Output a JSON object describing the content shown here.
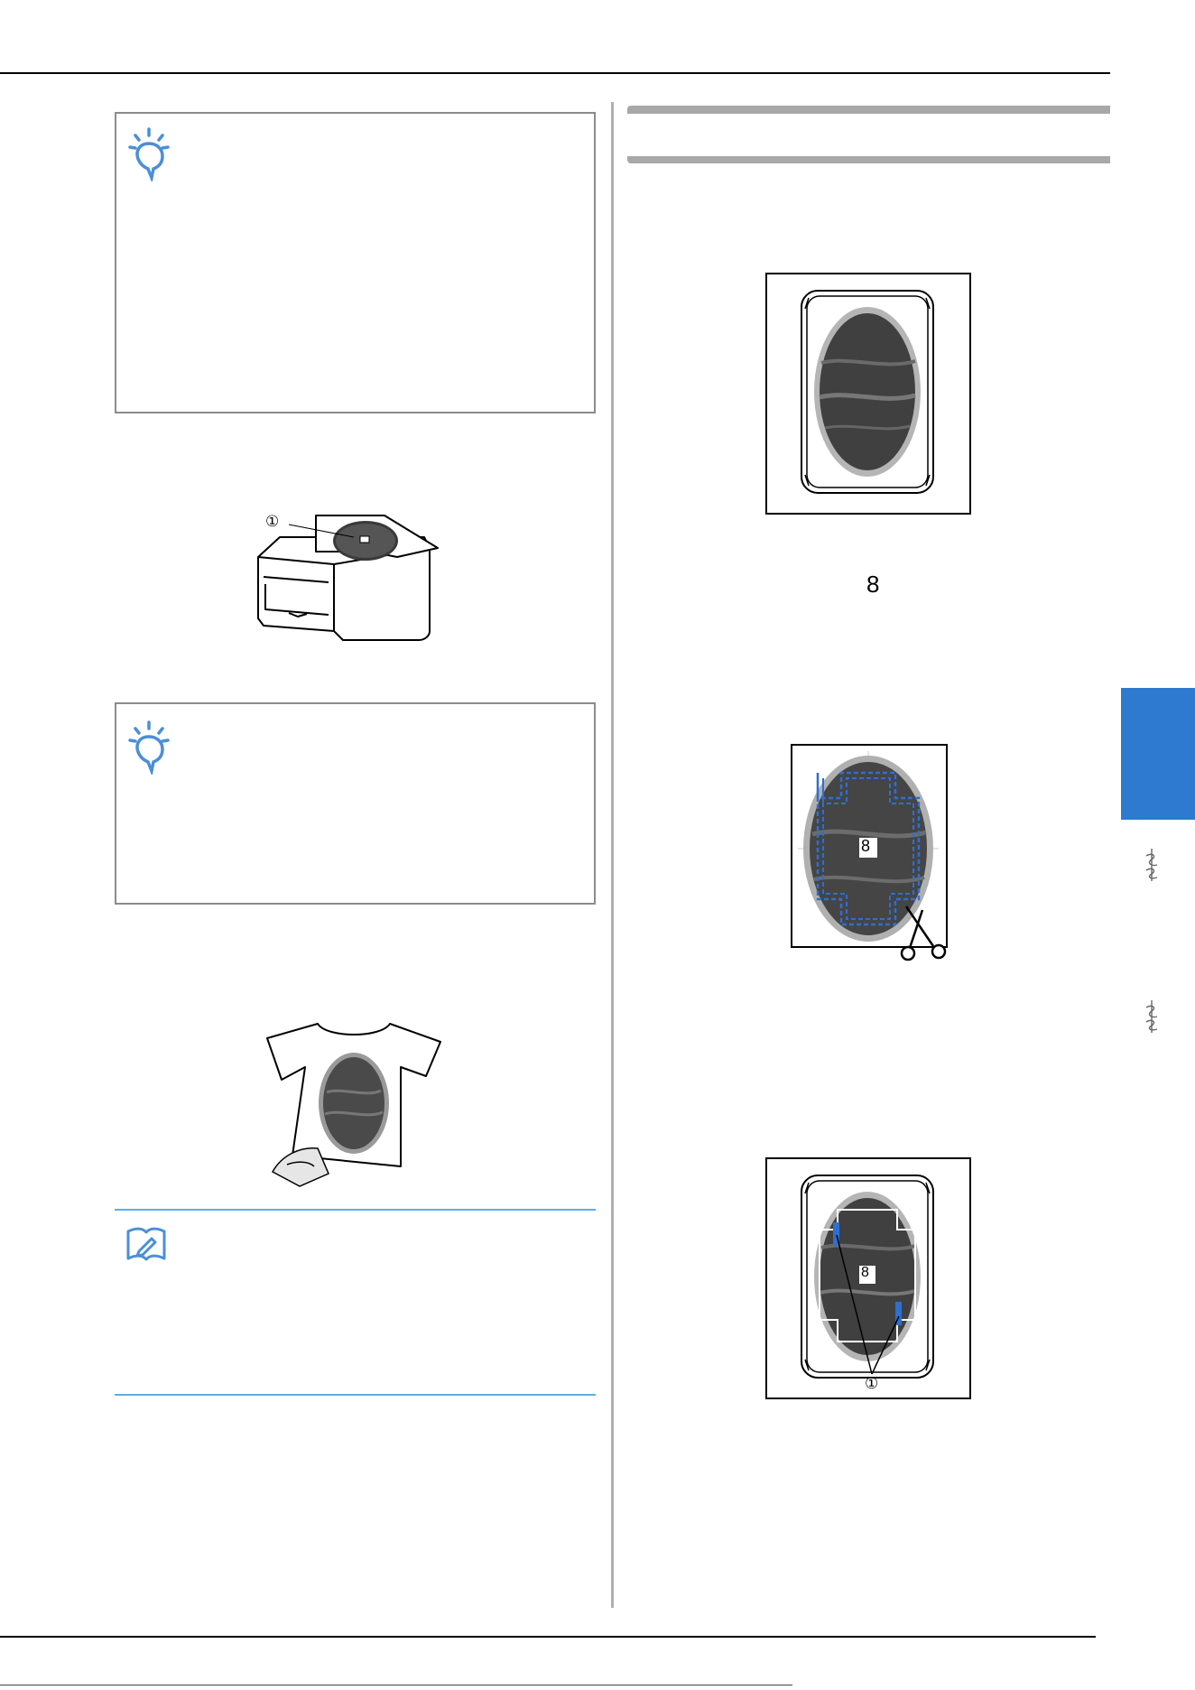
{
  "figures": {
    "hoop_top": {
      "name": "hoop-figure-top"
    },
    "ironing": {
      "label": "①"
    },
    "cut_figure": {
      "center_mark": "8"
    },
    "inline_mark": "8",
    "tshirt": {
      "name": "tshirt-figure"
    },
    "hoop_bottom": {
      "center_mark": "8",
      "label": "①"
    }
  },
  "icons": {
    "note_1": "lightbulb-note-icon",
    "note_2": "lightbulb-note-icon",
    "memo": "memo-pencil-icon",
    "side_ornament_1": "ornament-icon",
    "side_ornament_2": "ornament-icon"
  },
  "colors": {
    "note_border": "#8c8c8c",
    "memo_rule": "#5aaee8",
    "side_tab": "#2e7ad1",
    "stitch_outline": "#2e6fd1",
    "accent_blue": "#4a8fd8"
  }
}
